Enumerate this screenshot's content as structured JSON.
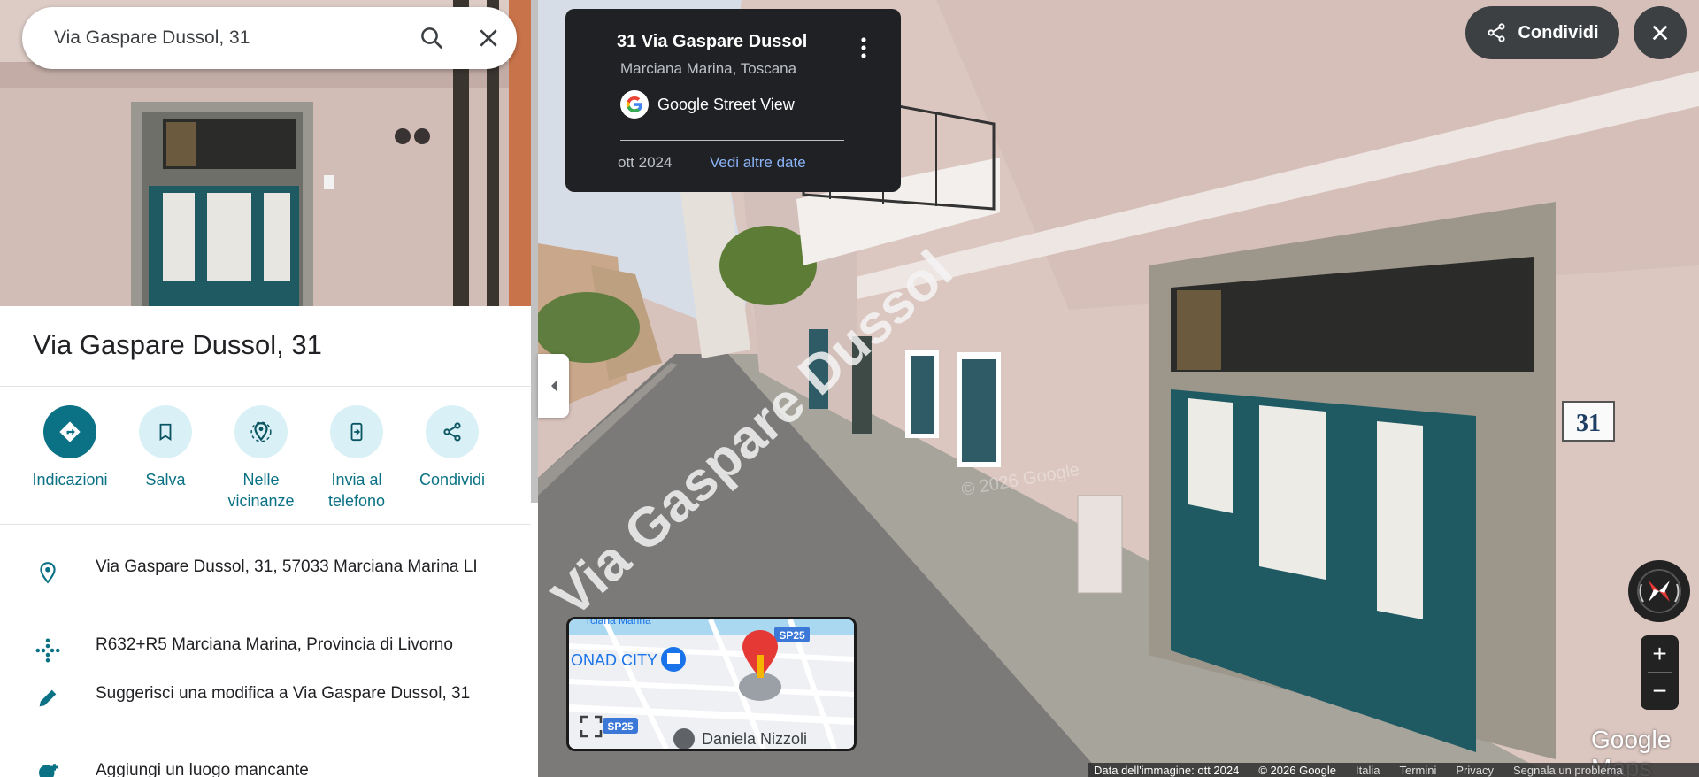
{
  "search": {
    "value": "Via Gaspare Dussol, 31"
  },
  "place": {
    "title": "Via Gaspare Dussol, 31"
  },
  "actions": [
    {
      "label": "Indicazioni",
      "icon": "directions-icon"
    },
    {
      "label": "Salva",
      "icon": "bookmark-icon"
    },
    {
      "label": "Nelle\nvicinanze",
      "icon": "nearby-icon"
    },
    {
      "label": "Invia al\ntelefono",
      "icon": "send-to-phone-icon"
    },
    {
      "label": "Condividi",
      "icon": "share-icon"
    }
  ],
  "info": {
    "address": "Via Gaspare Dussol, 31, 57033 Marciana Marina LI",
    "plus_code": "R632+R5 Marciana Marina, Provincia di Livorno",
    "suggest_edit": "Suggerisci una modifica a Via Gaspare Dussol, 31",
    "add_place": "Aggiungi un luogo mancante"
  },
  "street_view_card": {
    "title": "31 Via Gaspare Dussol",
    "subtitle": "Marciana Marina, Toscana",
    "source": "Google Street View",
    "date": "ott 2024",
    "more_dates": "Vedi altre date"
  },
  "top_right": {
    "share_label": "Condividi"
  },
  "zoom": {
    "in": "+",
    "out": "−"
  },
  "minimap": {
    "label_city": "ONAD CITY",
    "label_road1": "SP25",
    "label_road2": "SP25",
    "label_person": "Daniela Nizzoli",
    "label_top": "rciana Marina"
  },
  "scene_labels": {
    "house_number": "31",
    "street_sign": "Via Gaspare Dussol",
    "watermark": "© 2026 Google"
  },
  "branding": {
    "logo": "Google Maps"
  },
  "footer": {
    "image_date": "Data dell'immagine: ott 2024",
    "copyright": "© 2026 Google",
    "country": "Italia",
    "terms": "Termini",
    "privacy": "Privacy",
    "report": "Segnala un problema"
  },
  "colors": {
    "accent": "#0b7285",
    "accent_light": "#d9f1f6",
    "card_bg": "#202124",
    "link": "#8ab4f8"
  }
}
